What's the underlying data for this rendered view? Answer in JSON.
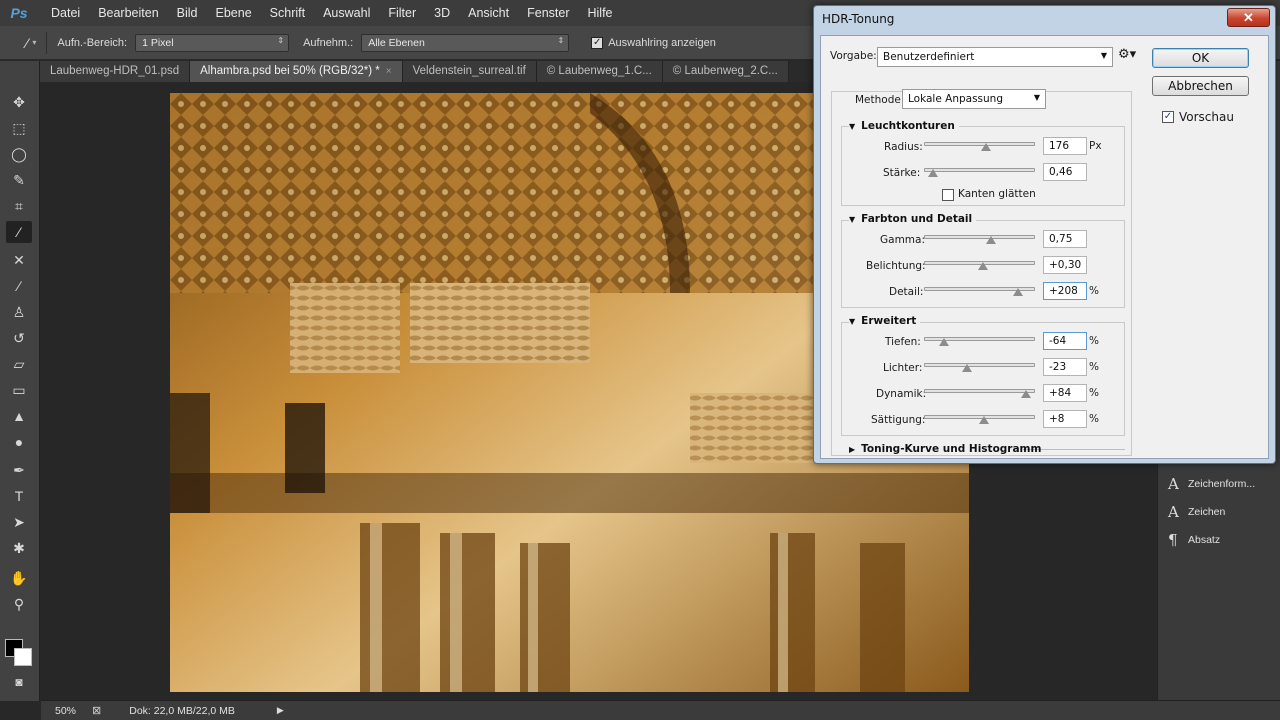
{
  "app": {
    "logo": "Ps"
  },
  "menu": [
    "Datei",
    "Bearbeiten",
    "Bild",
    "Ebene",
    "Schrift",
    "Auswahl",
    "Filter",
    "3D",
    "Ansicht",
    "Fenster",
    "Hilfe"
  ],
  "options": {
    "sample_size_label": "Aufn.-Bereich:",
    "sample_size_value": "1 Pixel",
    "sample_label": "Aufnehm.:",
    "sample_value": "Alle Ebenen",
    "show_ring_label": "Auswahlring anzeigen",
    "show_ring_checked": true
  },
  "tabs": [
    {
      "label": "Laubenweg-HDR_01.psd",
      "active": false
    },
    {
      "label": "Alhambra.psd bei 50% (RGB/32*) *",
      "active": true,
      "close": "×"
    },
    {
      "label": "Veldenstein_surreal.tif",
      "active": false
    },
    {
      "label": "© Laubenweg_1.C...",
      "active": false
    },
    {
      "label": "© Laubenweg_2.C...",
      "active": false
    }
  ],
  "status": {
    "zoom": "50%",
    "doc": "Dok: 22,0 MB/22,0 MB"
  },
  "right_panel": {
    "items": [
      {
        "icon": "A",
        "label": "Zeichenform..."
      },
      {
        "icon": "A",
        "label": "Zeichen"
      },
      {
        "icon": "¶",
        "label": "Absatz"
      }
    ]
  },
  "dialog": {
    "title": "HDR-Tonung",
    "close": "✕",
    "preset_label": "Vorgabe:",
    "preset_value": "Benutzerdefiniert",
    "ok": "OK",
    "cancel": "Abbrechen",
    "preview_label": "Vorschau",
    "preview_checked": true,
    "method_label": "Methode:",
    "method_value": "Lokale Anpassung",
    "sections": {
      "edge_glow": {
        "title": "Leuchtkonturen",
        "radius": {
          "label": "Radius:",
          "value": "176",
          "unit": "Px",
          "pos": 0.56
        },
        "strength": {
          "label": "Stärke:",
          "value": "0,46",
          "unit": "",
          "pos": 0.08
        },
        "smooth_edges": {
          "label": "Kanten glätten",
          "checked": false
        }
      },
      "tone_detail": {
        "title": "Farbton und Detail",
        "gamma": {
          "label": "Gamma:",
          "value": "0,75",
          "unit": "",
          "pos": 0.6
        },
        "exposure": {
          "label": "Belichtung:",
          "value": "+0,30",
          "unit": "",
          "pos": 0.53
        },
        "detail": {
          "label": "Detail:",
          "value": "+208",
          "unit": "%",
          "pos": 0.85
        }
      },
      "advanced": {
        "title": "Erweitert",
        "shadows": {
          "label": "Tiefen:",
          "value": "-64",
          "unit": "%",
          "pos": 0.18
        },
        "highlights": {
          "label": "Lichter:",
          "value": "-23",
          "unit": "%",
          "pos": 0.39
        },
        "vibrance": {
          "label": "Dynamik:",
          "value": "+84",
          "unit": "%",
          "pos": 0.92
        },
        "saturation": {
          "label": "Sättigung:",
          "value": "+8",
          "unit": "%",
          "pos": 0.54
        }
      },
      "toning_curve": {
        "title": "Toning-Kurve und Histogramm"
      }
    }
  },
  "colors": {
    "accent": "#4fa3e0",
    "dialog_frame": "#c3d3e6",
    "photo": "#a06a20"
  }
}
